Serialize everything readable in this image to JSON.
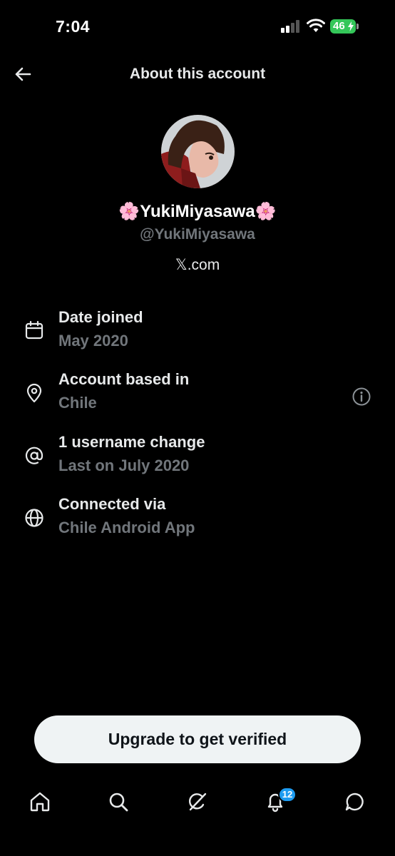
{
  "status_bar": {
    "time": "7:04",
    "battery": "46"
  },
  "header": {
    "title": "About this account",
    "back_icon": "arrow-left-icon"
  },
  "profile": {
    "display_name": "🌸YukiMiyasawa🌸",
    "handle": "@YukiMiyasawa",
    "website": "𝕏.com"
  },
  "info": [
    {
      "icon": "calendar-icon",
      "title": "Date joined",
      "value": "May 2020"
    },
    {
      "icon": "location-pin-icon",
      "title": "Account based in",
      "value": "Chile"
    },
    {
      "icon": "at-sign-icon",
      "title": "1 username change",
      "value": "Last on July 2020"
    },
    {
      "icon": "globe-icon",
      "title": "Connected via",
      "value": "Chile Android App"
    }
  ],
  "upgrade": {
    "label": "Upgrade to get verified"
  },
  "nav": {
    "items": [
      "home-icon",
      "search-icon",
      "grok-icon",
      "notifications-icon",
      "messages-icon"
    ],
    "notification_count": "12"
  },
  "colors": {
    "background": "#000000",
    "secondary_text": "#71767b",
    "badge": "#1d9bf0",
    "battery": "#34c759"
  }
}
